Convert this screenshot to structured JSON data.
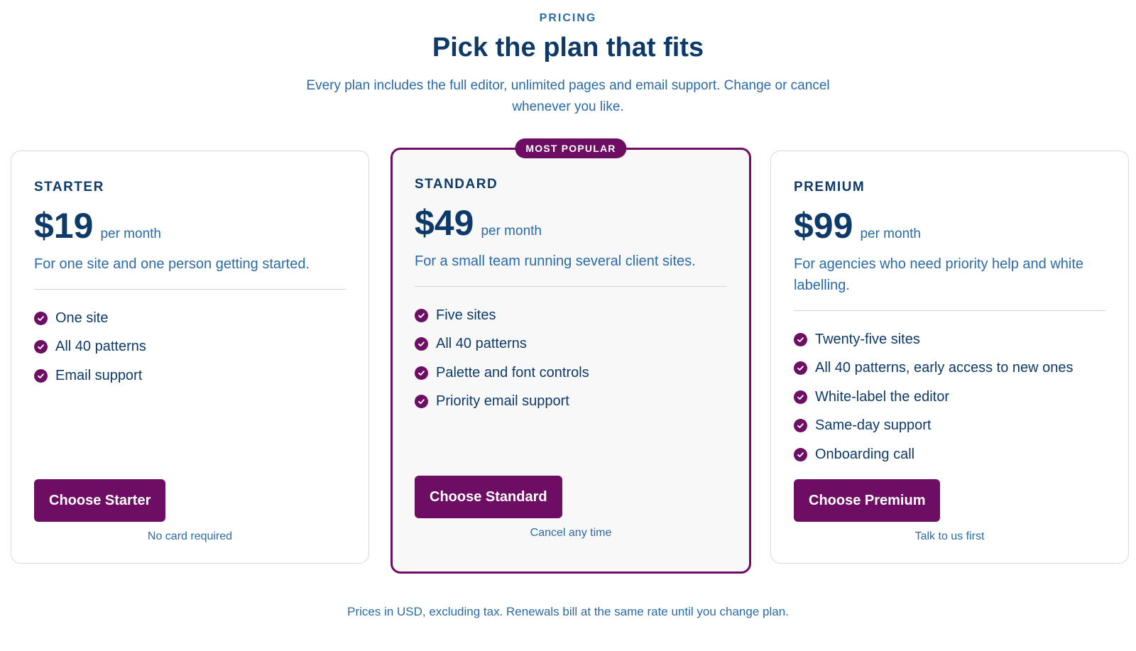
{
  "header": {
    "eyebrow": "PRICING",
    "title": "Pick the plan that fits",
    "subtitle": "Every plan includes the full editor, unlimited pages and email support. Change or cancel whenever you like."
  },
  "plans": [
    {
      "name": "STARTER",
      "price": "$19",
      "period": "per month",
      "description": "For one site and one person getting started.",
      "features": [
        "One site",
        "All 40 patterns",
        "Email support"
      ],
      "cta": "Choose Starter",
      "note": "No card required"
    },
    {
      "badge": "MOST POPULAR",
      "name": "STANDARD",
      "price": "$49",
      "period": "per month",
      "description": "For a small team running several client sites.",
      "features": [
        "Five sites",
        "All 40 patterns",
        "Palette and font controls",
        "Priority email support"
      ],
      "cta": "Choose Standard",
      "note": "Cancel any time"
    },
    {
      "name": "PREMIUM",
      "price": "$99",
      "period": "per month",
      "description": "For agencies who need priority help and white labelling.",
      "features": [
        "Twenty-five sites",
        "All 40 patterns, early access to new ones",
        "White-label the editor",
        "Same-day support",
        "Onboarding call"
      ],
      "cta": "Choose Premium",
      "note": "Talk to us first"
    }
  ],
  "footer": {
    "note": "Prices in USD, excluding tax. Renewals bill at the same rate until you change plan."
  },
  "colors": {
    "brand": "#6d0d63",
    "heading": "#0d3a68",
    "text": "#2a6aa8"
  },
  "icons": {
    "feature": "check-circle-icon"
  }
}
